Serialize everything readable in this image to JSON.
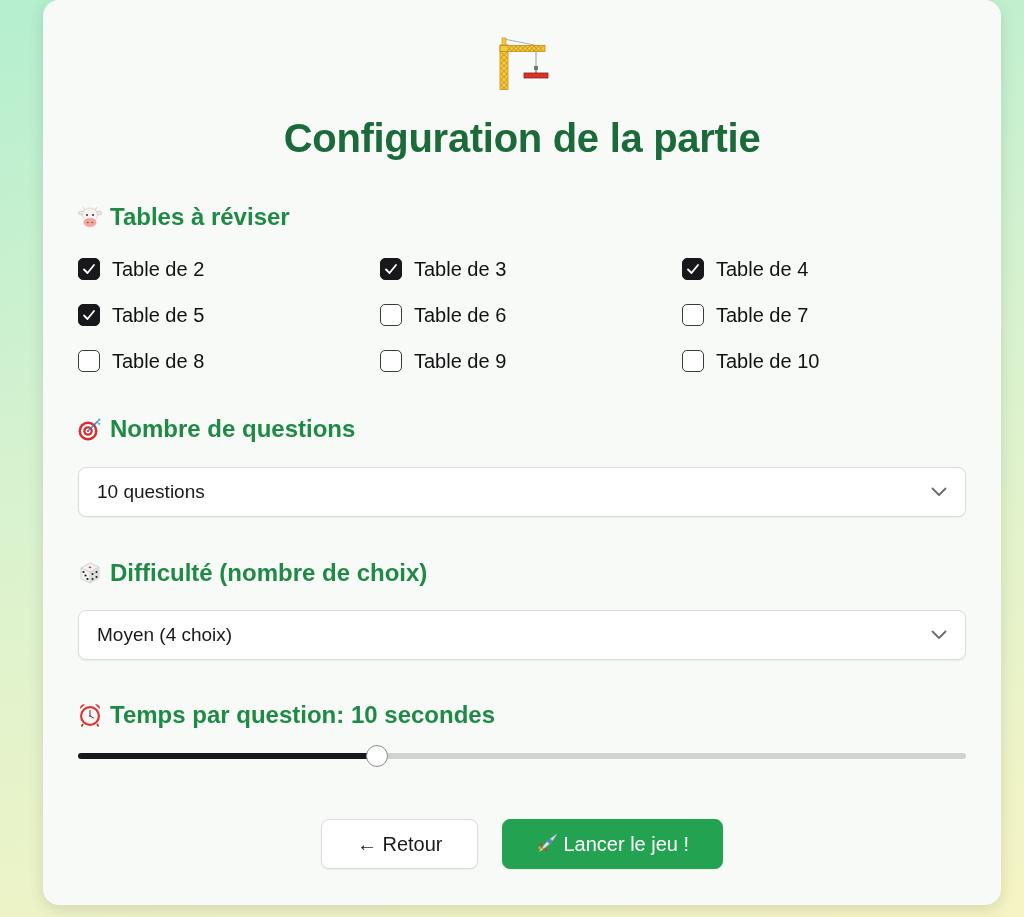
{
  "header": {
    "title": "Configuration de la partie"
  },
  "tables": {
    "heading": "Tables à réviser",
    "options": [
      {
        "label": "Table de 2",
        "checked": true
      },
      {
        "label": "Table de 3",
        "checked": true
      },
      {
        "label": "Table de 4",
        "checked": true
      },
      {
        "label": "Table de 5",
        "checked": true
      },
      {
        "label": "Table de 6",
        "checked": false
      },
      {
        "label": "Table de 7",
        "checked": false
      },
      {
        "label": "Table de 8",
        "checked": false
      },
      {
        "label": "Table de 9",
        "checked": false
      },
      {
        "label": "Table de 10",
        "checked": false
      }
    ]
  },
  "questions": {
    "heading": "Nombre de questions",
    "value": "10 questions"
  },
  "difficulty": {
    "heading": "Difficulté (nombre de choix)",
    "value": "Moyen (4 choix)"
  },
  "time": {
    "heading": "Temps par question: 10 secondes",
    "level": 0.337
  },
  "buttons": [
    {
      "label": "← Retour",
      "kind": "secondary"
    },
    {
      "label": "Lancer le jeu !",
      "kind": "primary"
    }
  ]
}
